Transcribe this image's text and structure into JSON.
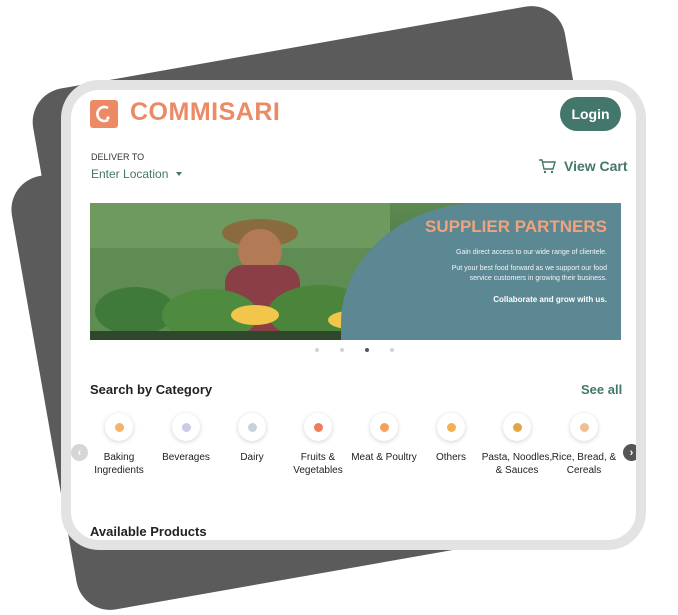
{
  "brand": {
    "name": "COMMISARI"
  },
  "header": {
    "login_label": "Login"
  },
  "delivery": {
    "label": "DELIVER TO",
    "location": "Enter Location"
  },
  "cart": {
    "label": "View Cart"
  },
  "banner": {
    "title": "SUPPLIER PARTNERS",
    "line1": "Gain direct access to our wide range of clientele.",
    "line2": "Put your best food forward as we support our food",
    "line3": "service customers in growing their business.",
    "cta": "Collaborate and grow with us."
  },
  "carousel": {
    "active_index": 2,
    "count": 4
  },
  "category_section": {
    "title": "Search by Category",
    "see_all": "See all",
    "items": [
      {
        "label": "Baking Ingredients",
        "icon": "baking-icon",
        "color": "#f2b36c"
      },
      {
        "label": "Beverages",
        "icon": "beverage-icon",
        "color": "#c9cbe6"
      },
      {
        "label": "Dairy",
        "icon": "dairy-icon",
        "color": "#c8d1dd"
      },
      {
        "label": "Fruits & Vegetables",
        "icon": "fruit-icon",
        "color": "#f07c5e"
      },
      {
        "label": "Meat & Poultry",
        "icon": "meat-icon",
        "color": "#f3a15e"
      },
      {
        "label": "Others",
        "icon": "others-icon",
        "color": "#f3b24f"
      },
      {
        "label": "Pasta, Noodles, & Sauces",
        "icon": "pasta-icon",
        "color": "#e0a843"
      },
      {
        "label": "Rice, Bread, & Cereals",
        "icon": "rice-icon",
        "color": "#efbe91"
      }
    ]
  },
  "available_section": {
    "title": "Available Products"
  },
  "colors": {
    "accent": "#44776b",
    "brand": "#ec8a66",
    "banner_panel": "#5b8892"
  }
}
